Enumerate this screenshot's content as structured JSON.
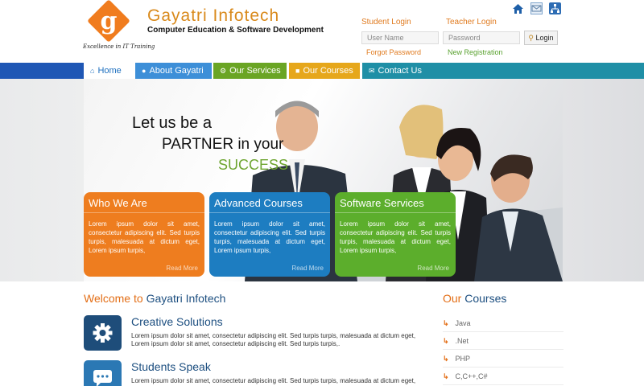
{
  "brand": {
    "logo_letter": "g",
    "tagline": "Excellence in IT Training",
    "name": "Gayatri Infotech",
    "subtitle": "Computer Education & Software Development"
  },
  "top_icons": [
    "home-icon",
    "mail-icon",
    "sitemap-icon"
  ],
  "login": {
    "student_title": "Student Login",
    "teacher_title": "Teacher Login",
    "username_placeholder": "User Name",
    "password_placeholder": "Password",
    "button_label": "Login",
    "forgot_label": "Forgot Password",
    "register_label": "New Registration"
  },
  "nav": [
    {
      "label": "Home",
      "icon": "home-icon",
      "color": "#ffffff",
      "text_color": "#1d6fbf"
    },
    {
      "label": "About Gayatri",
      "icon": "users-icon",
      "color": "#3d8fd8"
    },
    {
      "label": "Our Services",
      "icon": "gears-icon",
      "color": "#6aa524"
    },
    {
      "label": "Our Courses",
      "icon": "book-icon",
      "color": "#e6a71b"
    },
    {
      "label": "Contact Us",
      "icon": "envelope-icon",
      "color": "#1f8fa6"
    }
  ],
  "banner": {
    "line1": "Let us be a",
    "line2": "PARTNER in your",
    "line3": "SUCCESS"
  },
  "features": [
    {
      "title": "Who We Are",
      "text": "Lorem ipsum dolor sit amet, consectetur adipiscing elit. Sed turpis turpis, malesuada at dictum eget, Lorem ipsum turpis,",
      "more": "Read More",
      "color": "#ee7d1f"
    },
    {
      "title": "Advanced Courses",
      "text": "Lorem ipsum dolor sit amet, consectetur adipiscing elit. Sed turpis turpis, malesuada at dictum eget, Lorem ipsum turpis,",
      "more": "Read More",
      "color": "#1d7dc1"
    },
    {
      "title": "Software Services",
      "text": "Lorem ipsum dolor sit amet, consectetur adipiscing elit. Sed turpis turpis, malesuada at dictum eget, Lorem ipsum turpis,",
      "more": "Read More",
      "color": "#5cae2c"
    }
  ],
  "welcome": {
    "prefix": "Welcome to",
    "name": "Gayatri Infotech"
  },
  "items": [
    {
      "title": "Creative Solutions",
      "icon": "gear-icon",
      "line1": "Lorem ipsum dolor sit amet, consectetur adipiscing elit. Sed turpis turpis, malesuada at dictum eget,",
      "line2": "Lorem ipsum dolor sit amet, consectetur adipiscing elit. Sed turpis turpis,."
    },
    {
      "title": "Students Speak",
      "icon": "chat-icon",
      "line1": "Lorem ipsum dolor sit amet, consectetur adipiscing elit. Sed turpis turpis, malesuada at dictum eget,",
      "line2": ""
    }
  ],
  "courses": {
    "prefix": "Our",
    "name": "Courses",
    "list": [
      "Java",
      ".Net",
      "PHP",
      "C,C++,C#"
    ]
  }
}
